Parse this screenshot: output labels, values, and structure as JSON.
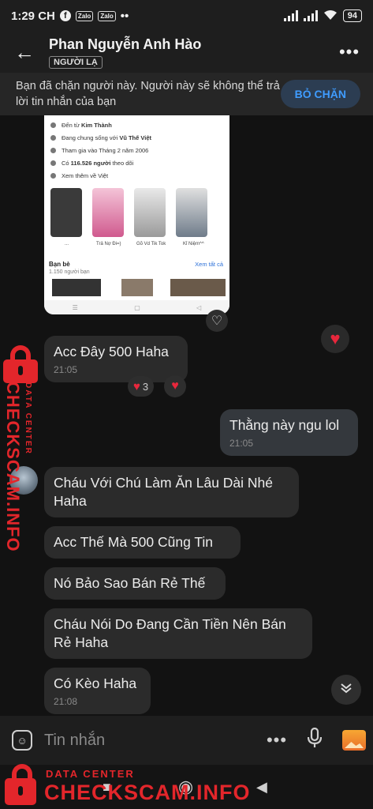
{
  "status_bar": {
    "time": "1:29 CH",
    "fb_icon": "f",
    "app_badge_1": "Zalo",
    "app_badge_2": "Zalo",
    "more": "••",
    "battery": "94"
  },
  "header": {
    "name": "Phan Nguyễn Anh Hào",
    "tag": "NGƯỜI LẠ",
    "back_glyph": "←",
    "more_glyph": "•••"
  },
  "banner": {
    "text": "Bạn đã chặn người này. Người này sẽ không thể trả lời tin nhắn của bạn",
    "button": "BỎ CHẶN"
  },
  "shared_image": {
    "rows": [
      {
        "prefix": "Đến từ ",
        "value": "Kim Thành"
      },
      {
        "prefix": "Đang chung sống với ",
        "value": "Vũ Thế Việt"
      },
      {
        "prefix": "Tham gia vào Tháng 2 năm 2006",
        "value": ""
      },
      {
        "prefix": "Có ",
        "value": "116.526 người",
        "suffix": " theo dõi"
      },
      {
        "prefix": "Xem thêm về Việt",
        "value": ""
      }
    ],
    "thumb_captions": [
      "...",
      "Trả Nợ Đi=)",
      "Gõ Vd Tik Tok",
      "Kỉ Niệm^^"
    ],
    "friends_label": "Bạn bè",
    "friends_count": "1.150 người bạn",
    "see_all": "Xem tất cả"
  },
  "messages": [
    {
      "text": "Acc Đây 500 Haha",
      "time": "21:05",
      "sender": "other",
      "reaction_count": "3"
    },
    {
      "text": "Thằng này ngu lol",
      "time": "21:05",
      "sender": "me"
    },
    {
      "text": "Cháu Với Chú Làm Ăn Lâu Dài Nhé Haha",
      "sender": "other"
    },
    {
      "text": "Acc Thế Mà 500 Cũng Tin",
      "sender": "other"
    },
    {
      "text": "Nó Bảo Sao Bán Rẻ Thế",
      "sender": "other"
    },
    {
      "text": "Cháu Nói Do Đang Cần Tiền Nên Bán Rẻ Haha",
      "sender": "other"
    },
    {
      "text": "Có Kèo Haha",
      "time": "21:08",
      "sender": "other"
    }
  ],
  "input": {
    "placeholder": "Tin nhắn",
    "more_glyph": "•••"
  },
  "watermark": {
    "title": "DATA CENTER",
    "site": "CHECKSCAM.INFO"
  },
  "icons": {
    "back": "arrow-left-icon",
    "more": "more-horizontal-icon",
    "heart": "heart-icon",
    "emoji": "sticker-icon",
    "mic": "mic-icon",
    "gallery": "gallery-icon",
    "scroll": "chevron-double-down-icon"
  },
  "colors": {
    "background": "#121212",
    "bubble": "#2b2b2b",
    "accent": "#3f9cff",
    "heart": "#e8273c",
    "watermark": "#e3262b"
  }
}
